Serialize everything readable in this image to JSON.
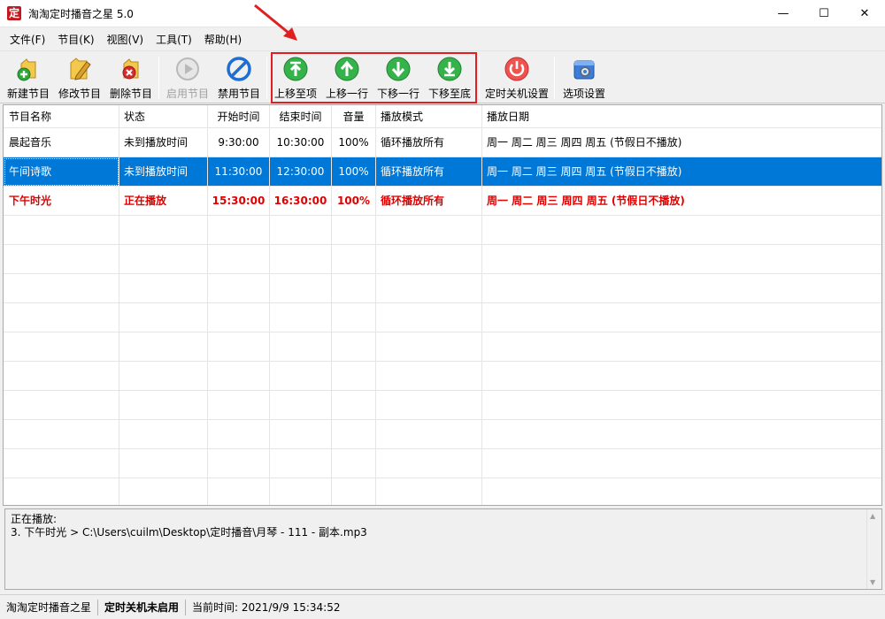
{
  "window": {
    "app_icon_char": "定",
    "title": "淘淘定时播音之星 5.0",
    "minimize": "—",
    "maximize": "☐",
    "close": "✕"
  },
  "menu": [
    "文件(F)",
    "节目(K)",
    "视图(V)",
    "工具(T)",
    "帮助(H)"
  ],
  "toolbar": {
    "new": "新建节目",
    "edit": "修改节目",
    "delete": "删除节目",
    "enable": "启用节目",
    "disable": "禁用节目",
    "move_top": "上移至项",
    "move_up": "上移一行",
    "move_down": "下移一行",
    "move_bottom": "下移至底",
    "shutdown": "定时关机设置",
    "options": "选项设置"
  },
  "colors": {
    "selection": "#0078d7",
    "playing_text": "#e00000",
    "highlight_box": "#e02020"
  },
  "table": {
    "headers": [
      "节目名称",
      "状态",
      "开始时间",
      "结束时间",
      "音量",
      "播放模式",
      "播放日期"
    ],
    "rows": [
      [
        "晨起音乐",
        "未到播放时间",
        "9:30:00",
        "10:30:00",
        "100%",
        "循环播放所有",
        "周一 周二 周三 周四 周五 (节假日不播放)"
      ],
      [
        "午间诗歌",
        "未到播放时间",
        "11:30:00",
        "12:30:00",
        "100%",
        "循环播放所有",
        "周一 周二 周三 周四 周五 (节假日不播放)"
      ],
      [
        "下午时光",
        "正在播放",
        "15:30:00",
        "16:30:00",
        "100%",
        "循环播放所有",
        "周一 周二 周三 周四 周五 (节假日不播放)"
      ]
    ]
  },
  "now_playing": {
    "label": "正在播放:",
    "track": "3. 下午时光 > C:\\Users\\cuilm\\Desktop\\定时播音\\月琴 - 111 - 副本.mp3"
  },
  "status": {
    "app": "淘淘定时播音之星",
    "shutdown": "定时关机未启用",
    "time": "当前时间: 2021/9/9 15:34:52"
  }
}
